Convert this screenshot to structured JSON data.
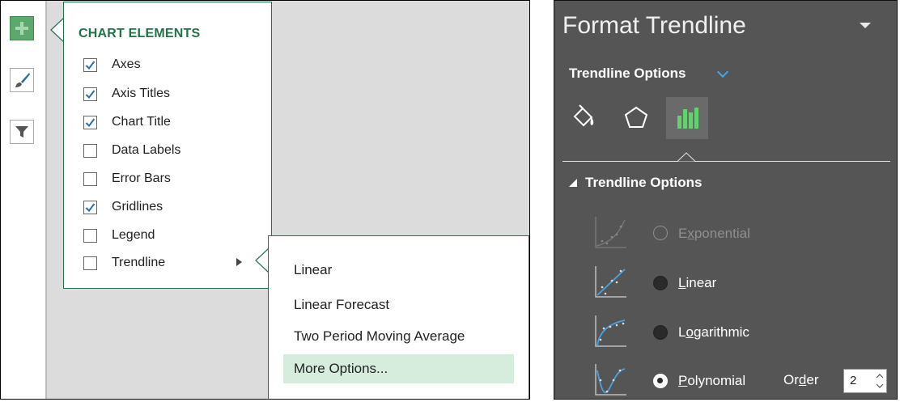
{
  "chart_elements": {
    "title": "CHART ELEMENTS",
    "items": [
      {
        "label": "Axes",
        "checked": true
      },
      {
        "label": "Axis Titles",
        "checked": true
      },
      {
        "label": "Chart Title",
        "checked": true
      },
      {
        "label": "Data Labels",
        "checked": false
      },
      {
        "label": "Error Bars",
        "checked": false
      },
      {
        "label": "Gridlines",
        "checked": true
      },
      {
        "label": "Legend",
        "checked": false
      },
      {
        "label": "Trendline",
        "checked": false
      }
    ]
  },
  "trendline_menu": {
    "items": [
      {
        "label": "Linear",
        "highlighted": false
      },
      {
        "label": "Linear Forecast",
        "highlighted": false
      },
      {
        "label": "Two Period Moving Average",
        "highlighted": false
      },
      {
        "label": "More Options...",
        "highlighted": true
      }
    ]
  },
  "format_pane": {
    "title": "Format Trendline",
    "options_dropdown": "Trendline Options",
    "tabs": [
      "fill-line-icon",
      "effects-icon",
      "trendline-options-icon"
    ],
    "section_title": "Trendline Options",
    "types": [
      {
        "label": "Exponential",
        "accel": "x",
        "selected": false,
        "enabled": false
      },
      {
        "label": "Linear",
        "accel": "L",
        "selected": false,
        "enabled": true
      },
      {
        "label": "Logarithmic",
        "accel": "o",
        "selected": false,
        "enabled": true
      },
      {
        "label": "Polynomial",
        "accel": "P",
        "selected": true,
        "enabled": true
      }
    ],
    "order_label": "Order",
    "order_value": "2"
  },
  "colors": {
    "excel_green": "#217346",
    "pane_bg": "#555555",
    "highlight": "#d6ecdc",
    "accent_blue": "#4aa3e0"
  }
}
